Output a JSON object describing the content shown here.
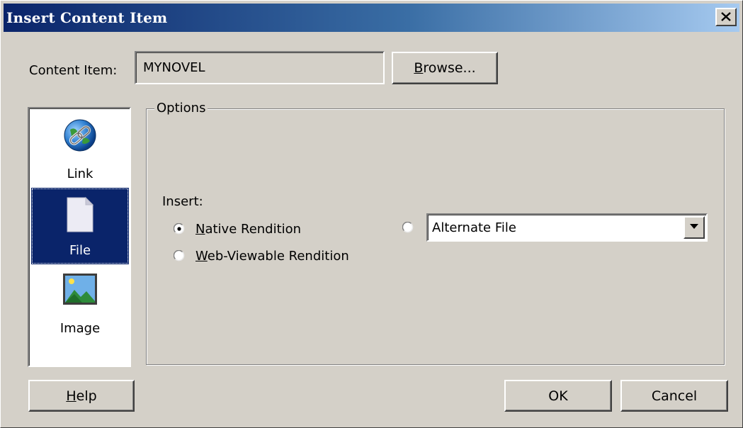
{
  "window": {
    "title": "Insert Content Item",
    "close_glyph": "✕"
  },
  "content_item": {
    "label": "Content Item:",
    "value": "MYNOVEL",
    "browse_label": "Browse..."
  },
  "sidebar": {
    "items": [
      {
        "label": "Link",
        "icon": "globe-link-icon",
        "selected": false
      },
      {
        "label": "File",
        "icon": "document-icon",
        "selected": true
      },
      {
        "label": "Image",
        "icon": "picture-icon",
        "selected": false
      }
    ]
  },
  "options": {
    "legend": "Options",
    "insert_label": "Insert:",
    "radios": [
      {
        "label": "Native Rendition",
        "checked": true
      },
      {
        "label": "Web-Viewable Rendition",
        "checked": false
      },
      {
        "label": "",
        "checked": false
      }
    ],
    "alternate_select": {
      "selected": "Alternate File"
    }
  },
  "footer": {
    "help_label": "Help",
    "ok_label": "OK",
    "cancel_label": "Cancel"
  },
  "colors": {
    "face": "#d4d0c8",
    "title_start": "#0a246a",
    "title_end": "#a6caf0",
    "selection": "#0a246a"
  }
}
